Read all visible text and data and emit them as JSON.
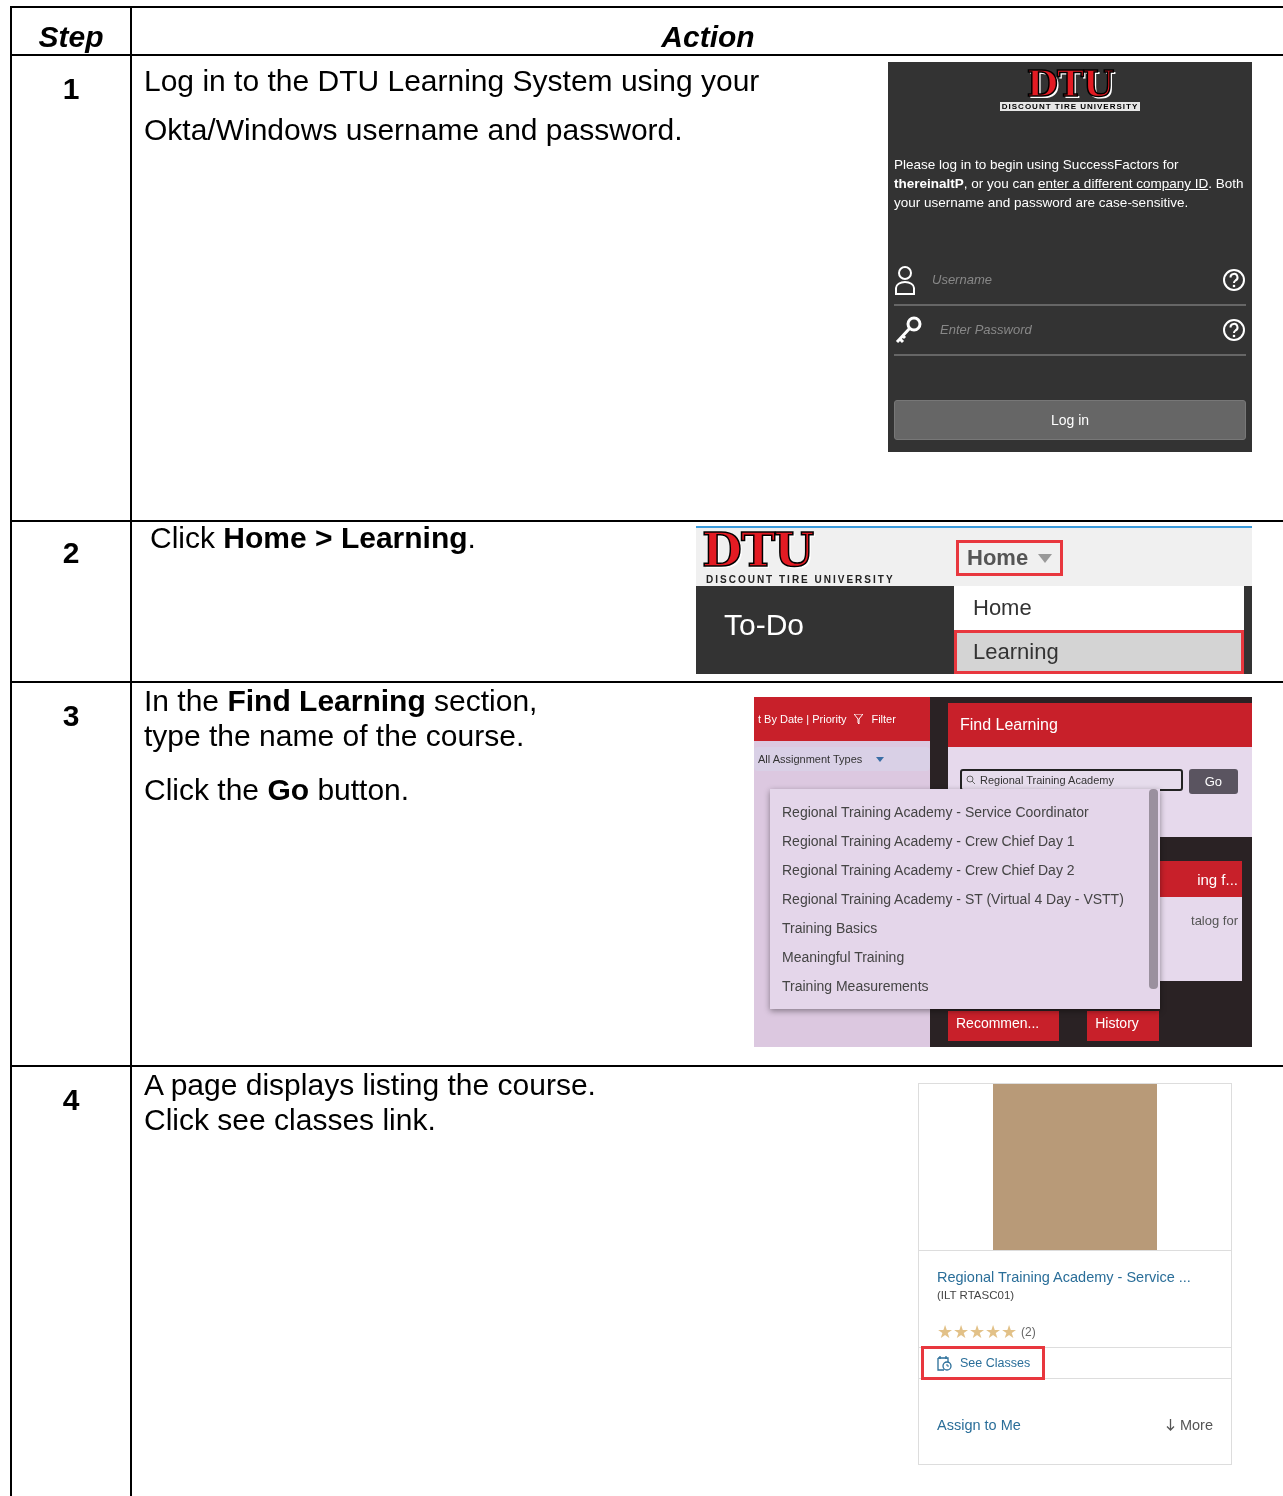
{
  "table": {
    "columns": [
      "Step",
      "Action"
    ],
    "rows": [
      {
        "step": "1",
        "instructions": [
          "Log in to the DTU Learning System using your Okta/Windows username and password."
        ],
        "screen": {
          "kind": "login",
          "logo": "DTU",
          "tagline": "DISCOUNT TIRE UNIVERSITY",
          "message": "Please log in to begin using SuccessFactors for **thereinaltP**, or you can",
          "link": "enter a different company ID",
          "message_end": ". Both your username and password are case-sensitive.",
          "fields": [
            {
              "kind": "user",
              "placeholder": "Username"
            },
            {
              "kind": "password",
              "placeholder": "Enter Password"
            }
          ],
          "button": "Log in"
        }
      },
      {
        "step": "2",
        "instructions": [
          "Click **Home > Learning**."
        ],
        "screen": {
          "kind": "nav",
          "logo": "DTU",
          "tagline": "DISCOUNT TIRE UNIVERSITY",
          "page_title": "To-Do",
          "menu_button": {
            "label": "Home",
            "highlighted": true
          },
          "menu_items": [
            {
              "label": "Home",
              "selected": false,
              "highlighted": false
            },
            {
              "label": "Learning",
              "selected": true,
              "highlighted": true
            }
          ]
        }
      },
      {
        "step": "3",
        "instructions": [
          "In the **Find Learning** section, type the name of the course.",
          "Click the **Go** button."
        ],
        "screen": {
          "kind": "search",
          "sort": "t By Date | Priority",
          "filter": "Filter",
          "assignment_types": "All Assignment Types",
          "panel_title": "Find Learning",
          "search_value": "Regional Training Academy",
          "go": "Go",
          "suggestions": [
            "Regional Training Academy - Service Coordinator",
            "Regional Training Academy - Crew Chief Day 1",
            "Regional Training Academy - Crew Chief Day 2",
            "Regional Training Academy - ST (Virtual 4 Day - VSTT)",
            "Training Basics",
            "Meaningful Training",
            "Training Measurements"
          ],
          "tile_title": "ing f...",
          "tile_text": "talog for",
          "bottom_tabs": [
            "Recommen...",
            "History"
          ]
        }
      },
      {
        "step": "4",
        "instructions": [
          "A page displays listing the course.",
          "Click see classes link."
        ],
        "screen": {
          "kind": "card",
          "title": "Regional Training Academy - Service ...",
          "code": "(ILT RTASC01)",
          "stars": 5,
          "rating_count": "(2)",
          "see_classes": {
            "label": "See Classes",
            "highlighted": true
          },
          "assign": "Assign to Me",
          "more": "More"
        }
      }
    ]
  }
}
